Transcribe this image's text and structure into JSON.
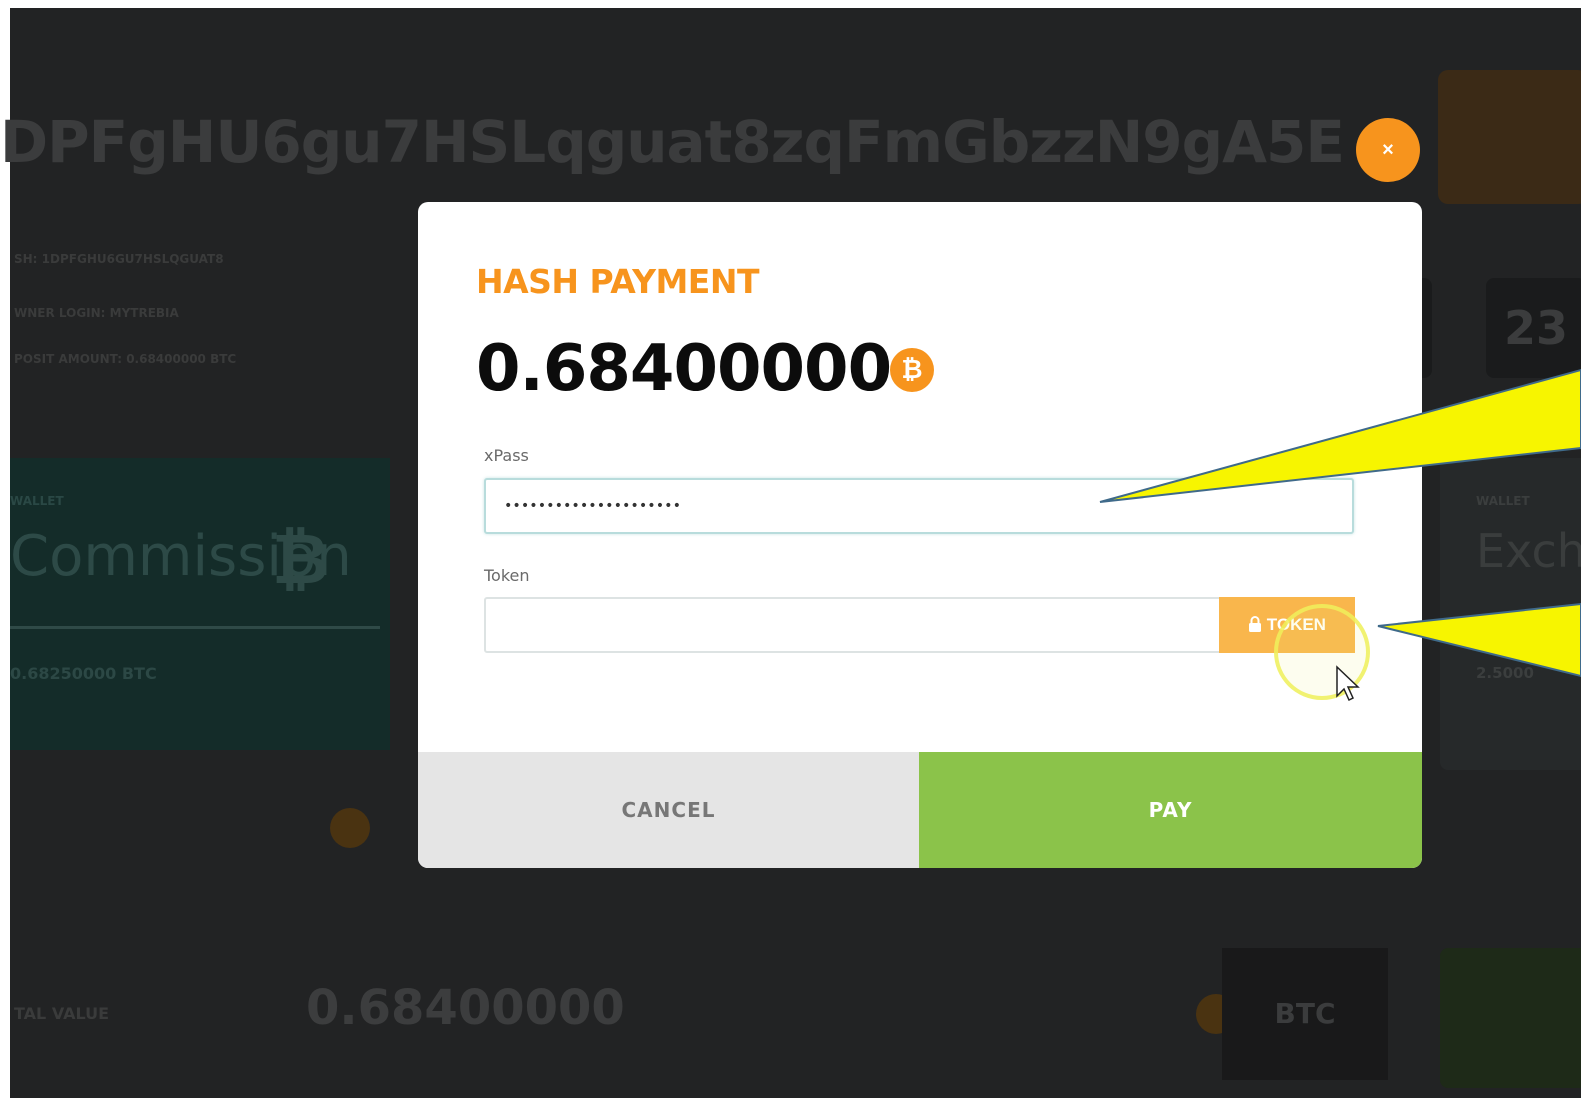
{
  "background": {
    "address_partial": "DPFgHU6gu7HSLqguat8zqFmGbzzN9gA5E",
    "info_lines": [
      "SH: 1DPFGHU6GU7HSLQGUAT8",
      "WNER LOGIN: MYTREBIA",
      "POSIT AMOUNT: 0.68400000 BTC"
    ],
    "right_box_number": "23",
    "wallet_left": {
      "label": "WALLET",
      "name": "Commission",
      "amount": "0.68250000 BTC"
    },
    "wallet_right": {
      "label": "WALLET",
      "name": "Exch",
      "amount": "2.5000"
    },
    "total_label": "TAL VALUE",
    "total_value": "0.68400000",
    "currency": "BTC"
  },
  "modal": {
    "title": "HASH PAYMENT",
    "amount": "0.68400000",
    "currency_icon": "bitcoin-icon",
    "close_label": "×",
    "xpass": {
      "label": "xPass",
      "value": "•••••••••••••••••••••"
    },
    "token": {
      "label": "Token",
      "value": "",
      "button_icon": "lock-icon",
      "button_label": "TOKEN"
    },
    "cancel_label": "CANCEL",
    "pay_label": "PAY"
  },
  "colors": {
    "accent": "#f7941d",
    "token_button": "#f9b64c",
    "pay": "#8bc34a",
    "cancel": "#e5e5e5",
    "callout": "#f7f500"
  }
}
